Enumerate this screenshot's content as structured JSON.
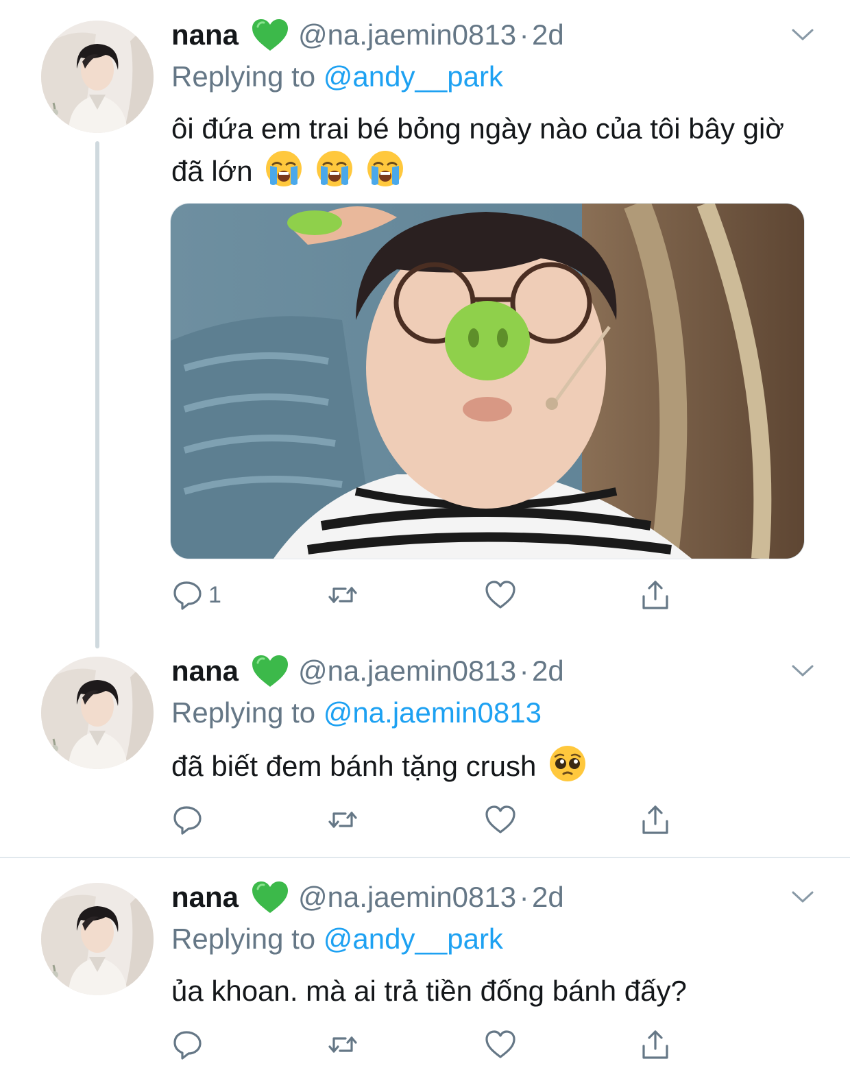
{
  "tweets": [
    {
      "name": "nana",
      "handle": "@na.jaemin0813",
      "separator": "·",
      "time": "2d",
      "replying_prefix": "Replying to ",
      "replying_to": "@andy__park",
      "text": "ôi đứa em trai bé bỏng ngày nào của tôi bây giờ đã lớn",
      "text_emojis": [
        "loudly-crying-face",
        "loudly-crying-face",
        "loudly-crying-face"
      ],
      "reply_count": "1"
    },
    {
      "name": "nana",
      "handle": "@na.jaemin0813",
      "separator": "·",
      "time": "2d",
      "replying_prefix": "Replying to ",
      "replying_to": "@na.jaemin0813",
      "text": "đã biết đem bánh tặng crush",
      "text_emojis": [
        "pleading-face"
      ],
      "reply_count": ""
    },
    {
      "name": "nana",
      "handle": "@na.jaemin0813",
      "separator": "·",
      "time": "2d",
      "replying_prefix": "Replying to ",
      "replying_to": "@andy__park",
      "text": "ủa khoan. mà ai trả tiền đống bánh đấy?",
      "text_emojis": [],
      "reply_count": ""
    }
  ],
  "icons": {
    "name_badge": "green-heart",
    "menu": "chevron-down",
    "actions": [
      "reply-icon",
      "retweet-icon",
      "like-icon",
      "share-icon"
    ]
  },
  "colors": {
    "text": "#14171a",
    "secondary": "#657786",
    "link": "#1da1f2",
    "thread_line": "#cfd9de",
    "badge_heart": "#3cb94a"
  }
}
